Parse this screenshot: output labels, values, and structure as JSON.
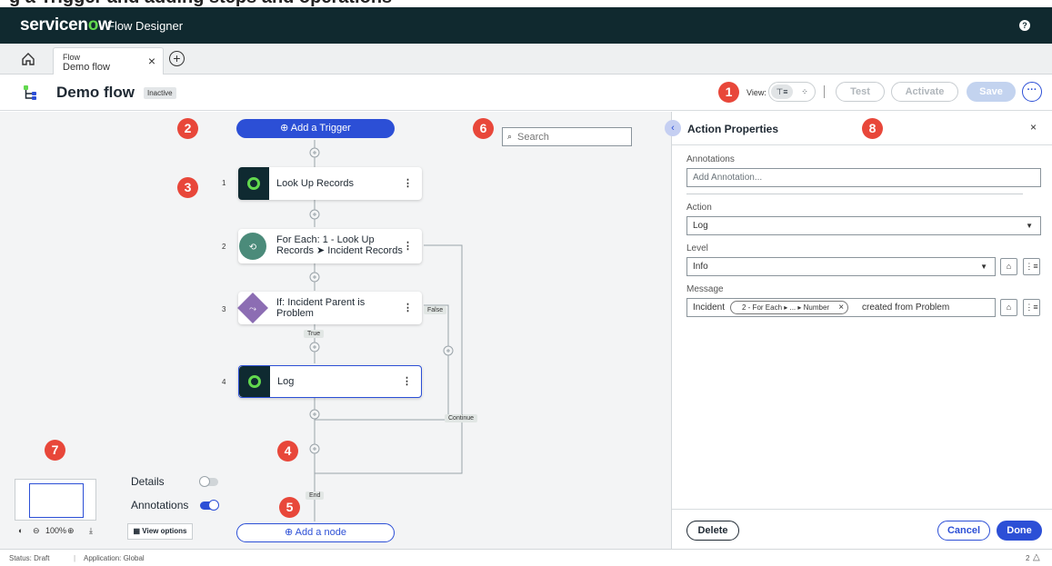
{
  "clip_text": "g a Trigger and adding steps and operations",
  "topbar": {
    "brand_prefix": "servicen",
    "brand_o": "o",
    "brand_suffix": "w",
    "app_name": "Flow Designer",
    "help_icon": "help-icon"
  },
  "tabs": {
    "home_icon": "home-icon",
    "active": {
      "type": "Flow",
      "name": "Demo flow"
    },
    "close": "×",
    "add": "+"
  },
  "header": {
    "title": "Demo flow",
    "status": "Inactive",
    "view_label": "View:",
    "buttons": {
      "test": "Test",
      "activate": "Activate",
      "save": "Save",
      "more": "···"
    }
  },
  "callouts": [
    "1",
    "2",
    "3",
    "4",
    "5",
    "6",
    "7",
    "8"
  ],
  "canvas": {
    "trigger_button": "⊕ Add a Trigger",
    "steps": [
      {
        "number": "1",
        "label": "Look Up Records"
      },
      {
        "number": "2",
        "label_line1": "For Each: 1 - Look Up",
        "label_line2": "Records ➤ Incident Records"
      },
      {
        "number": "3",
        "label_line1": "If: Incident Parent is",
        "label_line2": "Problem"
      },
      {
        "number": "4",
        "label": "Log"
      }
    ],
    "tags": {
      "false": "False",
      "true": "True",
      "continue": "Continue",
      "end": "End"
    },
    "add_node": "⊕ Add a node",
    "search_placeholder": "Search",
    "details_label": "Details",
    "annotations_label": "Annotations",
    "details_on": false,
    "annotations_on": true,
    "zoom": "100%",
    "view_options": "View options"
  },
  "panel": {
    "title": "Action Properties",
    "close": "×",
    "annotations_label": "Annotations",
    "annotations_placeholder": "Add Annotation...",
    "action_label": "Action",
    "action_value": "Log",
    "level_label": "Level",
    "level_value": "Info",
    "message_label": "Message",
    "message_prefix": "Incident",
    "message_pill": "2 - For Each ▸ ... ▸ Number",
    "message_suffix": "created from Problem",
    "delete": "Delete",
    "cancel": "Cancel",
    "done": "Done"
  },
  "statusbar": {
    "status": "Status: Draft",
    "application": "Application: Global",
    "count": "2",
    "alert_icon": "bell-icon"
  },
  "colors": {
    "topbar": "#10292f",
    "accent": "#2c4fd6",
    "green": "#62d84e",
    "callout": "#e8473a",
    "canvas": "#f3f4f5"
  }
}
